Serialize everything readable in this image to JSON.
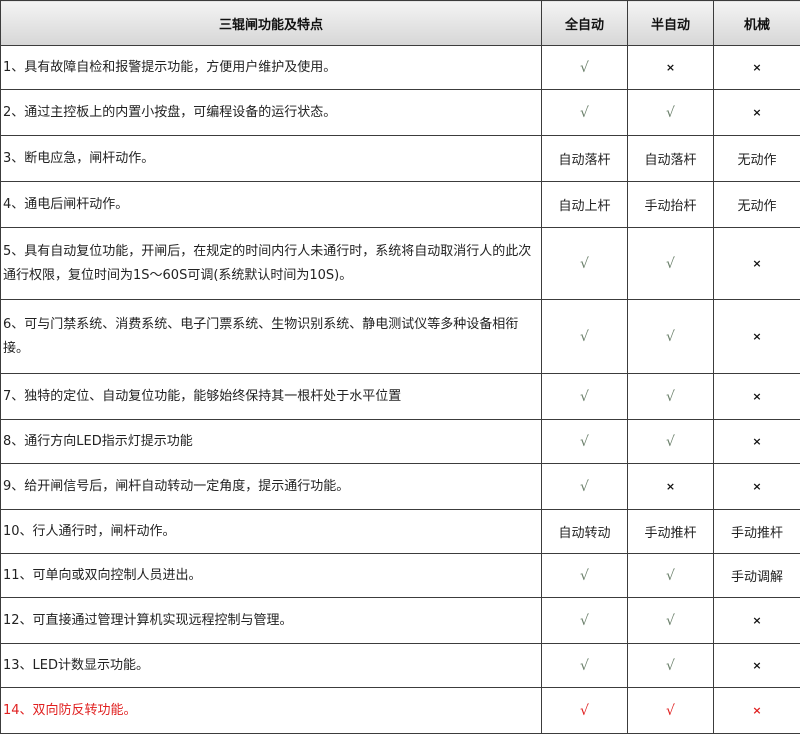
{
  "table": {
    "headers": [
      "三辊闸功能及特点",
      "全自动",
      "半自动",
      "机械"
    ],
    "rows": [
      {
        "desc": "1、具有故障自检和报警提示功能，方便用户维护及使用。",
        "cells": [
          "√",
          "×",
          "×"
        ]
      },
      {
        "desc": "2、通过主控板上的内置小按盘，可编程设备的运行状态。",
        "cells": [
          "√",
          "√",
          "×"
        ]
      },
      {
        "desc": "3、断电应急，闸杆动作。",
        "cells": [
          "自动落杆",
          "自动落杆",
          "无动作"
        ]
      },
      {
        "desc": "4、通电后闸杆动作。",
        "cells": [
          "自动上杆",
          "手动抬杆",
          "无动作"
        ]
      },
      {
        "desc": "5、具有自动复位功能，开闸后，在规定的时间内行人未通行时，系统将自动取消行人的此次通行权限，复位时间为1S～60S可调(系统默认时间为10S)。",
        "cells": [
          "√",
          "√",
          "×"
        ]
      },
      {
        "desc": "6、可与门禁系统、消费系统、电子门票系统、生物识别系统、静电测试仪等多种设备相衔接。",
        "cells": [
          "√",
          "√",
          "×"
        ]
      },
      {
        "desc": "7、独特的定位、自动复位功能，能够始终保持其一根杆处于水平位置",
        "cells": [
          "√",
          "√",
          "×"
        ]
      },
      {
        "desc": "8、通行方向LED指示灯提示功能",
        "cells": [
          "√",
          "√",
          "×"
        ]
      },
      {
        "desc": "9、给开闸信号后，闸杆自动转动一定角度，提示通行功能。",
        "cells": [
          "√",
          "×",
          "×"
        ]
      },
      {
        "desc": "10、行人通行时，闸杆动作。",
        "cells": [
          "自动转动",
          "手动推杆",
          "手动推杆"
        ]
      },
      {
        "desc": "11、可单向或双向控制人员进出。",
        "cells": [
          "√",
          "√",
          "手动调解"
        ]
      },
      {
        "desc": "12、可直接通过管理计算机实现远程控制与管理。",
        "cells": [
          "√",
          "√",
          "×"
        ]
      },
      {
        "desc": "13、LED计数显示功能。",
        "cells": [
          "√",
          "√",
          "×"
        ]
      },
      {
        "desc": "14、双向防反转功能。",
        "cells": [
          "√",
          "√",
          "×"
        ],
        "highlight": true
      }
    ],
    "highlight_color": "#e02020"
  }
}
